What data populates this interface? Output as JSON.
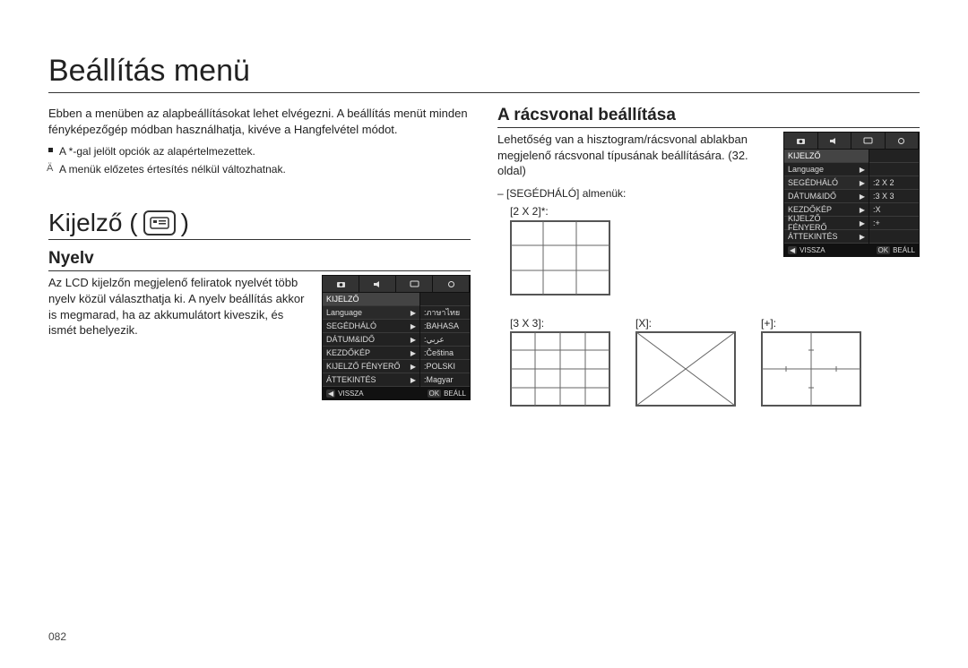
{
  "page_number": "082",
  "title": "Beállítás menü",
  "intro": "Ebben a menüben az alapbeállításokat lehet elvégezni. A beállítás menüt minden fényképezőgép módban használhatja, kivéve a Hangfelvétel módot.",
  "note_default": "A *-gal jelölt opciók az alapértelmezettek.",
  "note_change": "A menük előzetes értesítés nélkül változhatnak.",
  "section_kijelzo": "Kijelző (",
  "section_kijelzo_close": ")",
  "nyelv": {
    "heading": "Nyelv",
    "text": "Az LCD kijelzőn megjelenő feliratok nyelvét több nyelv közül választhatja ki. A nyelv beállítás akkor is megmarad, ha az akkumulátort kiveszik, és ismét behelyezik."
  },
  "racs": {
    "heading": "A rácsvonal beállítása",
    "text": "Lehetőség van a hisztogram/rácsvonal ablakban megjelenő rácsvonal típusának beállítására. (32. oldal)",
    "submenu_label": "– [SEGÉDHÁLÓ] almenük:",
    "opt_2x2": "[2 X 2]*:",
    "opt_3x3": "[3 X 3]:",
    "opt_x": "[X]:",
    "opt_plus": "[+]:"
  },
  "menu1": {
    "header": "KIJELZŐ",
    "rows": [
      {
        "l": "Language",
        "r": ":ภาษาไทย"
      },
      {
        "l": "SEGÉDHÁLÓ",
        "r": ":BAHASA"
      },
      {
        "l": "DÁTUM&IDŐ",
        "r": ":عربي"
      },
      {
        "l": "KEZDŐKÉP",
        "r": ":Čeština"
      },
      {
        "l": "KIJELZŐ FÉNYERŐ",
        "r": ":POLSKI"
      },
      {
        "l": "ÁTTEKINTÉS",
        "r": ":Magyar"
      }
    ],
    "foot_l": "VISSZA",
    "foot_r": "BEÁLL",
    "foot_ok": "OK"
  },
  "menu2": {
    "header": "KIJELZŐ",
    "rows": [
      {
        "l": "Language",
        "r": ""
      },
      {
        "l": "SEGÉDHÁLÓ",
        "r": ":2 X 2"
      },
      {
        "l": "DÁTUM&IDŐ",
        "r": ":3 X 3"
      },
      {
        "l": "KEZDŐKÉP",
        "r": ":X"
      },
      {
        "l": "KIJELZŐ FÉNYERŐ",
        "r": ":+"
      },
      {
        "l": "ÁTTEKINTÉS",
        "r": ""
      }
    ],
    "foot_l": "VISSZA",
    "foot_r": "BEÁLL",
    "foot_ok": "OK"
  }
}
